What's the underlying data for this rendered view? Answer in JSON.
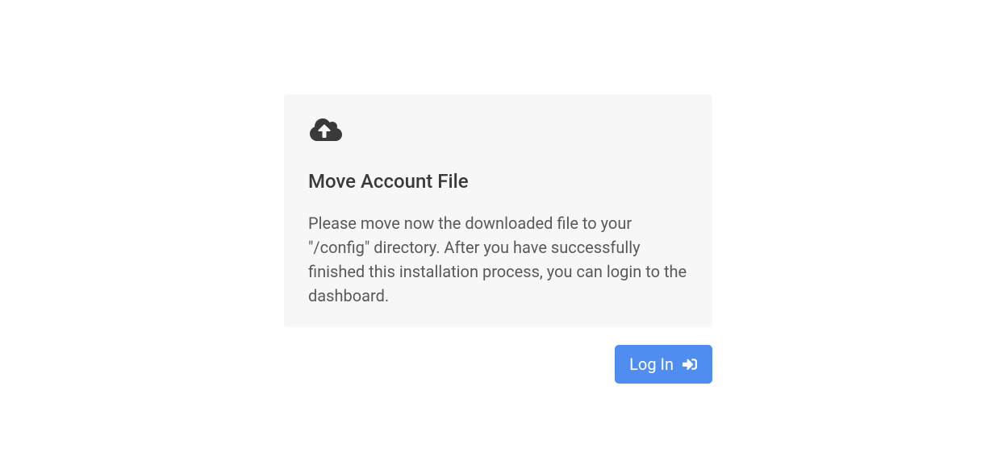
{
  "card": {
    "title": "Move Account File",
    "body": "Please move now the downloaded file to your \"/config\" directory. After you have successfully finished this installation process, you can login to the dashboard."
  },
  "actions": {
    "login_label": "Log In"
  }
}
